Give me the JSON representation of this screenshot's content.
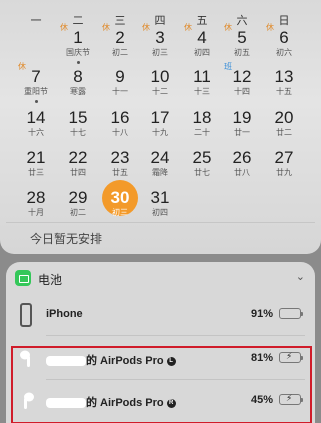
{
  "calendar": {
    "weekdays": [
      "一",
      "二",
      "三",
      "四",
      "五",
      "六",
      "日"
    ],
    "weeks": [
      [
        {
          "day": "",
          "lunar": "",
          "tag": ""
        },
        {
          "day": "1",
          "lunar": "国庆节",
          "tag": "休",
          "dot": true
        },
        {
          "day": "2",
          "lunar": "初二",
          "tag": "休"
        },
        {
          "day": "3",
          "lunar": "初三",
          "tag": "休"
        },
        {
          "day": "4",
          "lunar": "初四",
          "tag": "休"
        },
        {
          "day": "5",
          "lunar": "初五",
          "tag": "休"
        },
        {
          "day": "6",
          "lunar": "初六",
          "tag": "休"
        }
      ],
      [
        {
          "day": "7",
          "lunar": "重阳节",
          "tag": "休",
          "dot": true
        },
        {
          "day": "8",
          "lunar": "寒露",
          "tag": ""
        },
        {
          "day": "9",
          "lunar": "十一",
          "tag": ""
        },
        {
          "day": "10",
          "lunar": "十二",
          "tag": ""
        },
        {
          "day": "11",
          "lunar": "十三",
          "tag": ""
        },
        {
          "day": "12",
          "lunar": "十四",
          "tag": "班",
          "tagBlue": true
        },
        {
          "day": "13",
          "lunar": "十五",
          "tag": ""
        }
      ],
      [
        {
          "day": "14",
          "lunar": "十六",
          "tag": ""
        },
        {
          "day": "15",
          "lunar": "十七",
          "tag": ""
        },
        {
          "day": "16",
          "lunar": "十八",
          "tag": ""
        },
        {
          "day": "17",
          "lunar": "十九",
          "tag": ""
        },
        {
          "day": "18",
          "lunar": "二十",
          "tag": ""
        },
        {
          "day": "19",
          "lunar": "廿一",
          "tag": ""
        },
        {
          "day": "20",
          "lunar": "廿二",
          "tag": ""
        }
      ],
      [
        {
          "day": "21",
          "lunar": "廿三",
          "tag": ""
        },
        {
          "day": "22",
          "lunar": "廿四",
          "tag": ""
        },
        {
          "day": "23",
          "lunar": "廿五",
          "tag": ""
        },
        {
          "day": "24",
          "lunar": "霜降",
          "tag": ""
        },
        {
          "day": "25",
          "lunar": "廿七",
          "tag": ""
        },
        {
          "day": "26",
          "lunar": "廿八",
          "tag": ""
        },
        {
          "day": "27",
          "lunar": "廿九",
          "tag": ""
        }
      ],
      [
        {
          "day": "28",
          "lunar": "十月",
          "tag": ""
        },
        {
          "day": "29",
          "lunar": "初二",
          "tag": ""
        },
        {
          "day": "30",
          "lunar": "初三",
          "tag": "",
          "today": true
        },
        {
          "day": "31",
          "lunar": "初四",
          "tag": ""
        },
        {
          "day": "",
          "lunar": "",
          "tag": ""
        },
        {
          "day": "",
          "lunar": "",
          "tag": ""
        },
        {
          "day": "",
          "lunar": "",
          "tag": ""
        }
      ]
    ],
    "no_events": "今日暂无安排",
    "today_color": "#f39a2a",
    "holiday_tag_color": "#e08a2a",
    "work_tag_color": "#3a8fd8"
  },
  "battery": {
    "title": "电池",
    "chevron": "⌄",
    "accent": "#34c759",
    "devices": [
      {
        "name": "iPhone",
        "percent": "91%",
        "level": 0.91,
        "charging": false,
        "icon": "iphone-icon"
      },
      {
        "name": "的 AirPods Pro",
        "badge": "L",
        "percent": "81%",
        "level": 0.81,
        "charging": true,
        "icon": "airpod-left-icon"
      },
      {
        "name": "的 AirPods Pro",
        "badge": "R",
        "percent": "45%",
        "level": 0.45,
        "charging": true,
        "icon": "airpod-right-icon"
      }
    ]
  },
  "highlight_color": "#d01c2a"
}
